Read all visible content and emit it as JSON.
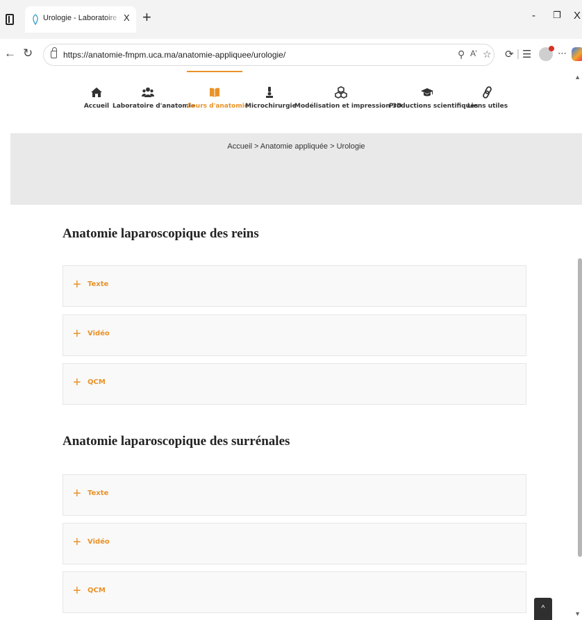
{
  "browser": {
    "tab_title": "Urologie - Laboratoire d'anatomie",
    "tab_close": "X",
    "new_tab": "+",
    "window_controls": {
      "minimize": "-",
      "restore": "❐",
      "close": "X"
    },
    "url": "https://anatomie-fmpm.uca.ma/anatomie-appliquee/urologie/"
  },
  "nav": {
    "accent_color": "#e8922a",
    "items": [
      {
        "label": "Accueil",
        "icon": "home-icon"
      },
      {
        "label": "Laboratoire d'anatomie",
        "icon": "users-icon"
      },
      {
        "label": "Cours d'anatomie",
        "icon": "book-icon",
        "active": true
      },
      {
        "label": "Microchirurgie",
        "icon": "microscope-icon"
      },
      {
        "label": "Modélisation et impression 3D",
        "icon": "cubes-icon"
      },
      {
        "label": "Productions scientifiques",
        "icon": "graduation-cap-icon"
      },
      {
        "label": "Liens utiles",
        "icon": "link-icon"
      }
    ]
  },
  "breadcrumb": "Accueil > Anatomie appliquée > Urologie",
  "sections": [
    {
      "title": "Anatomie laparoscopique des reins",
      "items": [
        {
          "label": "Texte"
        },
        {
          "label": "Vidéo"
        },
        {
          "label": "QCM"
        }
      ]
    },
    {
      "title": "Anatomie laparoscopique des surrénales",
      "items": [
        {
          "label": "Texte"
        },
        {
          "label": "Vidéo"
        },
        {
          "label": "QCM"
        }
      ]
    }
  ],
  "back_to_top": "^"
}
